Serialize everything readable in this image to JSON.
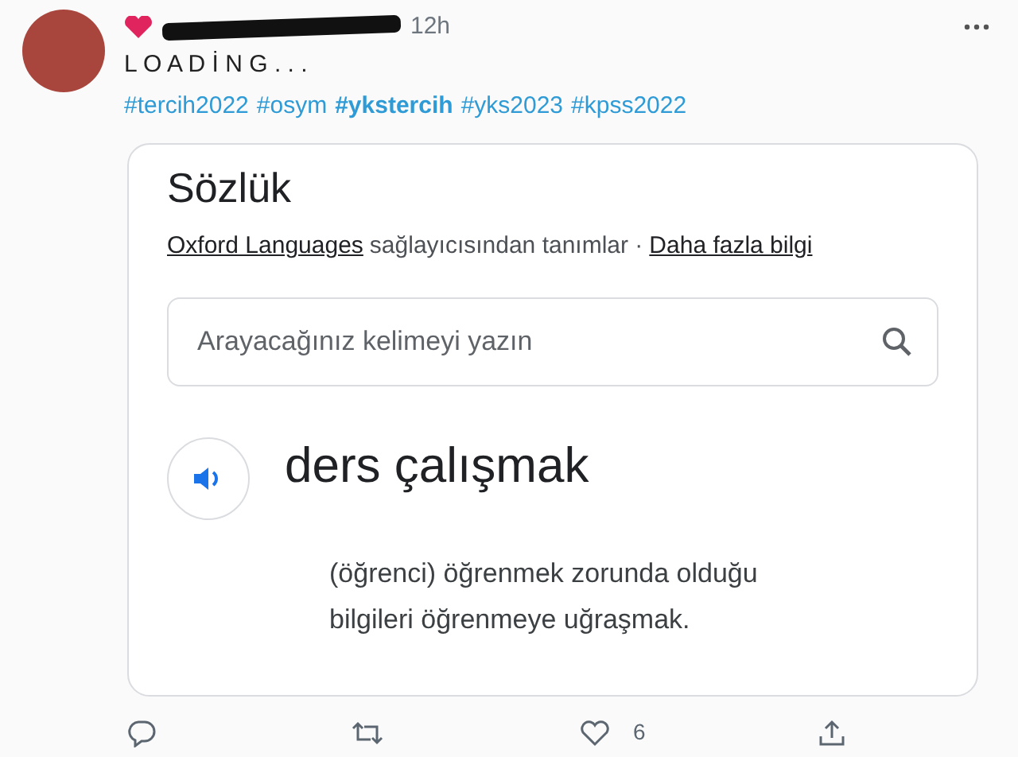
{
  "tweet": {
    "time": "12h",
    "text": "L O A D İ N G . . .",
    "hashtags": [
      {
        "text": "#tercih2022",
        "bold": false
      },
      {
        "text": "#osym",
        "bold": false
      },
      {
        "text": "#ykstercih",
        "bold": true
      },
      {
        "text": "#yks2023",
        "bold": false
      },
      {
        "text": "#kpss2022",
        "bold": false
      }
    ]
  },
  "dictionary": {
    "title": "Sözlük",
    "source_link": "Oxford Languages",
    "source_text": "sağlayıcısından tanımlar ·",
    "more_link": "Daha fazla bilgi",
    "search": {
      "placeholder": "Arayacağınız kelimeyi yazın"
    },
    "word": "ders çalışmak",
    "definition": "(öğrenci) öğrenmek zorunda olduğu bilgileri öğrenmeye uğraşmak."
  },
  "actions": {
    "like_count": "6"
  }
}
